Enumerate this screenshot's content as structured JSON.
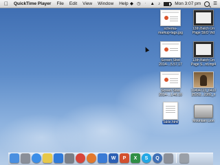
{
  "menubar": {
    "app_name": "QuickTime Player",
    "menus": [
      "File",
      "Edit",
      "View",
      "Window",
      "Help"
    ],
    "clock": "Mon 3:07 pm",
    "battery_level": 0.7
  },
  "desktop_items": [
    {
      "label_line1": "schema-",
      "label_line2": "markup-tags.jpg",
      "icon": "image-thumbnail-icon"
    },
    {
      "label_line1": "13th Batch On",
      "label_line2": "Page SEO Vid",
      "icon": "video-thumbnail-icon"
    },
    {
      "label_line1": "Screen Shot",
      "label_line2": "2014-...5.57.17",
      "icon": "screenshot-thumbnail-icon"
    },
    {
      "label_line1": "13th Batch On",
      "label_line2": "Page S...rd.mp4",
      "icon": "video-thumbnail-icon"
    },
    {
      "label_line1": "Screen Shot",
      "label_line2": "2014-...1.46.10",
      "icon": "screenshot-thumbnail-icon"
    },
    {
      "label_line1": "10494723_6410",
      "label_line2": "25292...2382_n",
      "icon": "photo-thumbnail-icon"
    },
    {
      "label_line1": "Table.html",
      "label_line2": "",
      "icon": "html-document-icon"
    },
    {
      "label_line1": "Mountain Lion",
      "label_line2": "",
      "icon": "hard-drive-icon"
    }
  ],
  "dock": [
    {
      "name": "finder-icon",
      "color": "#4a8fe0",
      "glyph": ""
    },
    {
      "name": "launchpad-icon",
      "color": "#8a8f99",
      "glyph": ""
    },
    {
      "name": "safari-icon",
      "color": "#3b8ee8",
      "glyph": ""
    },
    {
      "name": "notes-icon",
      "color": "#e7c84a",
      "glyph": ""
    },
    {
      "name": "app-store-icon",
      "color": "#2f7ad9",
      "glyph": ""
    },
    {
      "name": "system-preferences-icon",
      "color": "#7a7f88",
      "glyph": ""
    },
    {
      "name": "chrome-icon",
      "color": "#d8453a",
      "glyph": ""
    },
    {
      "name": "firefox-icon",
      "color": "#e2782c",
      "glyph": ""
    },
    {
      "name": "app-icon",
      "color": "#3a7bd5",
      "glyph": ""
    },
    {
      "name": "word-icon",
      "color": "#2b5fb4",
      "glyph": "W"
    },
    {
      "name": "powerpoint-icon",
      "color": "#d2502f",
      "glyph": "P"
    },
    {
      "name": "excel-icon",
      "color": "#2f8f46",
      "glyph": "X"
    },
    {
      "name": "skype-icon",
      "color": "#22a7e5",
      "glyph": "S"
    },
    {
      "name": "quicktime-icon",
      "color": "#3e6fb6",
      "glyph": "Q"
    },
    {
      "name": "settings-app-icon",
      "color": "#8c9099",
      "glyph": ""
    },
    {
      "name": "trash-icon",
      "color": "#9aa0a8",
      "glyph": ""
    }
  ]
}
